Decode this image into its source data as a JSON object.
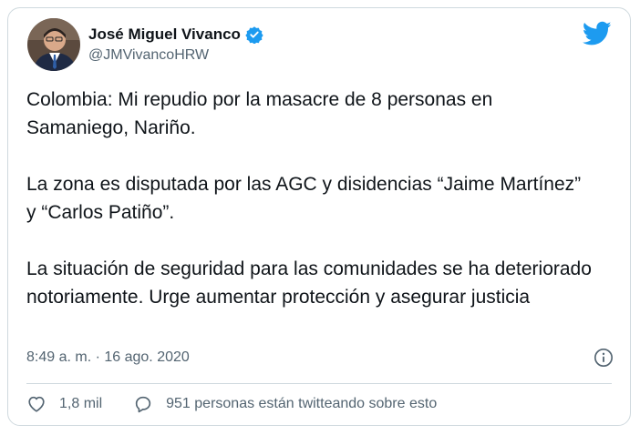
{
  "author": {
    "display_name": "José Miguel Vivanco",
    "handle": "@JMVivancoHRW",
    "verified": true
  },
  "tweet": {
    "paragraphs": [
      "Colombia: Mi repudio por la masacre de 8 personas en Samaniego, Nariño.",
      "La zona es disputada por las AGC y disidencias “Jaime Martínez” y “Carlos Patiño”.",
      "La situación de seguridad para las comunidades se ha deteriorado notoriamente. Urge aumentar protección y asegurar justicia"
    ],
    "timestamp": "8:49 a. m. · 16 ago. 2020"
  },
  "actions": {
    "likes_label": "1,8 mil",
    "conversation_label": "951 personas están twitteando sobre esto"
  },
  "icons": {
    "avatar": "avatar",
    "verified": "verified-badge-icon",
    "logo": "twitter-bird-icon",
    "info": "info-icon",
    "like": "heart-icon",
    "reply": "speech-bubble-icon"
  },
  "colors": {
    "brand": "#1d9bf0",
    "text": "#0f1419",
    "muted": "#536471",
    "border": "#cfd9de"
  }
}
